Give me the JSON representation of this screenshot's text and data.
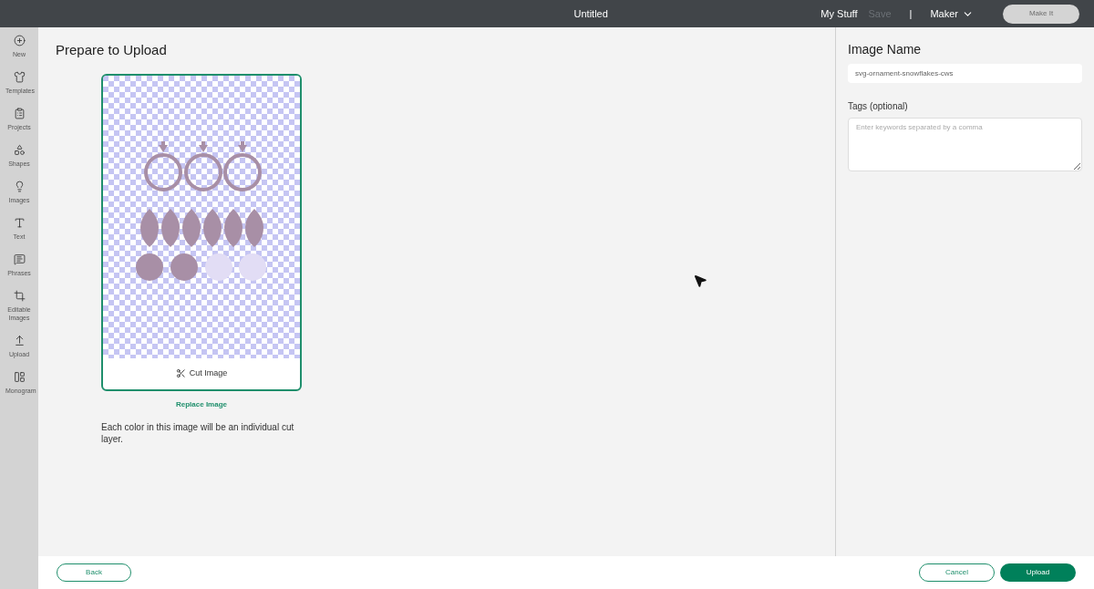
{
  "top_bar": {
    "title": "Untitled",
    "links": [
      {
        "label": "My Stuff",
        "disabled": false
      },
      {
        "label": "Save",
        "disabled": true
      }
    ],
    "separator": "|",
    "machine": "Maker",
    "make_button": {
      "label": "Make It",
      "disabled": true
    }
  },
  "sidebar": {
    "items": [
      {
        "label": "New"
      },
      {
        "label": "Templates"
      },
      {
        "label": "Projects"
      },
      {
        "label": "Shapes"
      },
      {
        "label": "Images"
      },
      {
        "label": "Text"
      },
      {
        "label": "Phrases"
      },
      {
        "label": "Editable Images"
      },
      {
        "label": "Upload"
      },
      {
        "label": "Monogram"
      }
    ]
  },
  "main": {
    "heading": "Prepare to Upload",
    "cut_option": "Cut Image",
    "replace_link": "Replace Image",
    "note": "Each color in this image will be an individual cut layer."
  },
  "details": {
    "name_label": "Image Name",
    "name_value": "svg-ornament-snowflakes-cws",
    "tags_label": "Tags (optional)",
    "tags_placeholder": "Enter keywords separated by a comma"
  },
  "footer": {
    "back": "Back",
    "cancel": "Cancel",
    "upload": "Upload"
  }
}
